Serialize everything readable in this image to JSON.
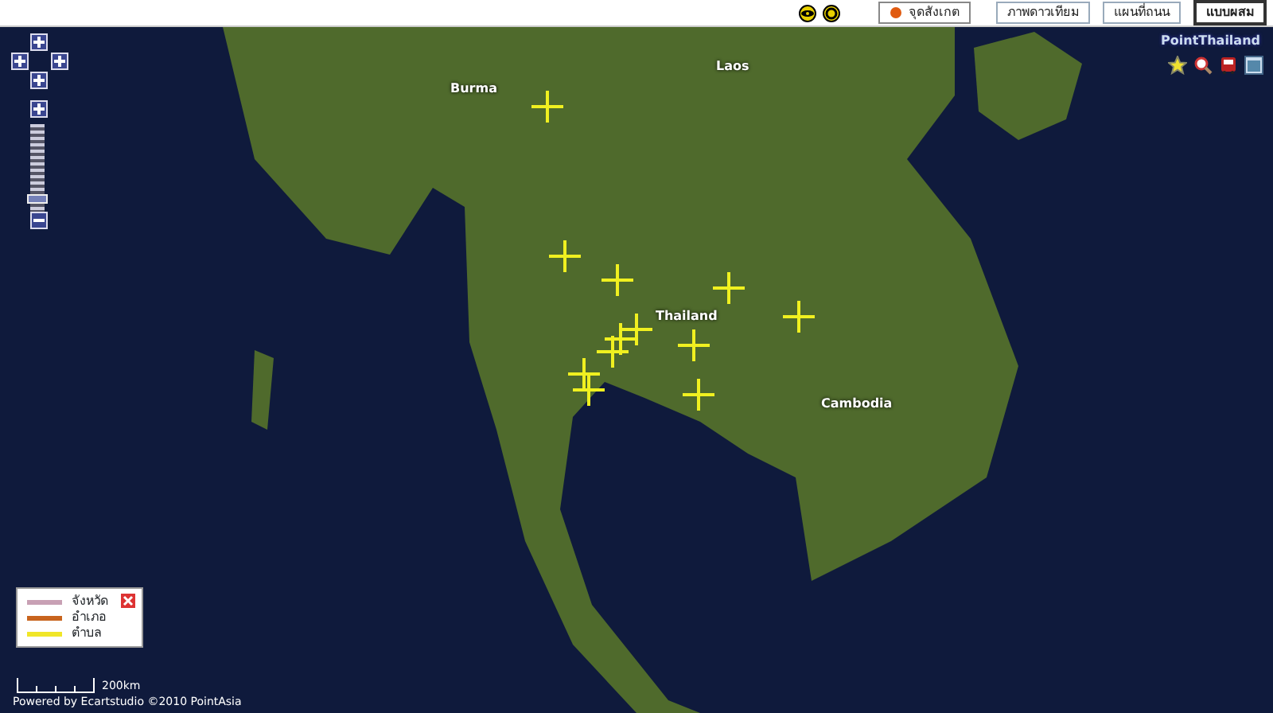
{
  "toolbar": {
    "buttons": [
      {
        "label": "จุดสังเกต",
        "kind": "poi"
      }
    ],
    "map_types": [
      {
        "label": "ภาพดาวเทียม",
        "selected": false
      },
      {
        "label": "แผนที่ถนน",
        "selected": false
      },
      {
        "label": "แบบผสม",
        "selected": true
      }
    ]
  },
  "logo": "PointThailand",
  "zoom": {
    "level": 0.1
  },
  "map_labels": [
    {
      "text": "Burma",
      "kind": "country"
    },
    {
      "text": "Laos",
      "kind": "country"
    },
    {
      "text": "Thailand",
      "kind": "country"
    },
    {
      "text": "Cambodia",
      "kind": "country"
    }
  ],
  "legend": [
    {
      "label": "จังหวัด",
      "color": "#c8a0b4"
    },
    {
      "label": "อำเภอ",
      "color": "#c8641e"
    },
    {
      "label": "ตำบล",
      "color": "#f0e628"
    }
  ],
  "scale": "200km",
  "footer": "Powered by Ecartstudio ©2010 PointAsia"
}
